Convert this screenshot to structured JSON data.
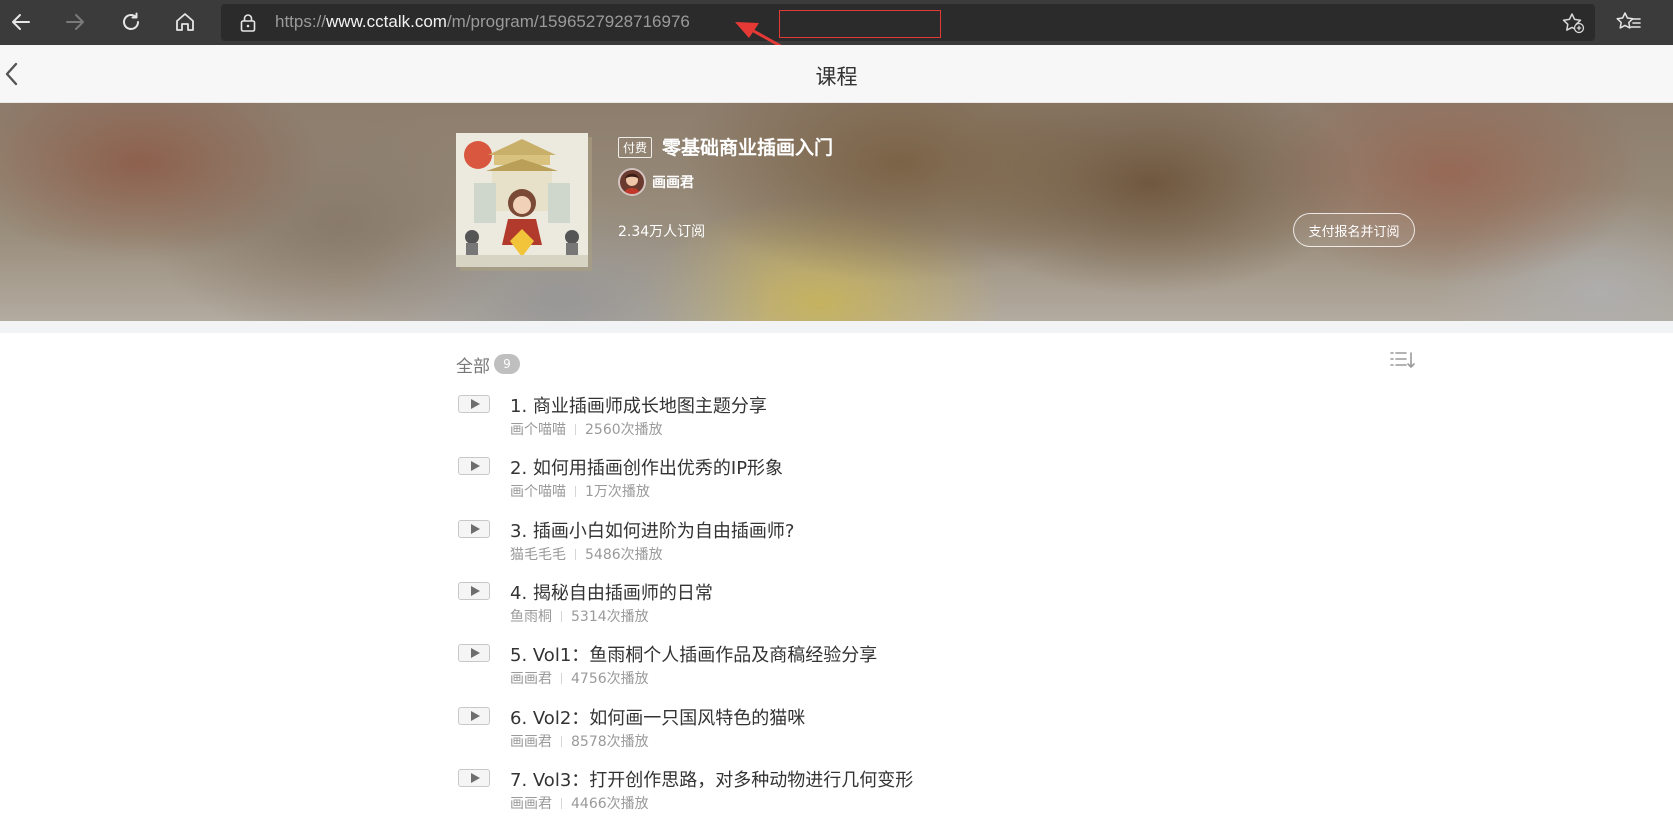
{
  "browser": {
    "url_prefix": "https://",
    "url_host": "www.cctalk.com",
    "url_path": "/m/program/",
    "url_id": "1596527928716976",
    "icons": [
      "back-icon",
      "forward-icon",
      "refresh-icon",
      "home-icon",
      "lock-icon",
      "add-favorite-icon",
      "favorites-icon"
    ]
  },
  "header": {
    "title": "课程"
  },
  "course": {
    "paid_tag": "付费",
    "title": "零基础商业插画入门",
    "author": "画画君",
    "subscribers": "2.34万人订阅",
    "subscribe_button": "支付报名并订阅"
  },
  "list": {
    "all_label": "全部",
    "count": "9",
    "lessons": [
      {
        "title": "1. 商业插画师成长地图主题分享",
        "author": "画个喵喵",
        "plays": "2560次播放"
      },
      {
        "title": "2. 如何用插画创作出优秀的IP形象",
        "author": "画个喵喵",
        "plays": "1万次播放"
      },
      {
        "title": "3. 插画小白如何进阶为自由插画师?",
        "author": "猫毛毛毛",
        "plays": "5486次播放"
      },
      {
        "title": "4. 揭秘自由插画师的日常",
        "author": "鱼雨桐",
        "plays": "5314次播放"
      },
      {
        "title": "5. Vol1：鱼雨桐个人插画作品及商稿经验分享",
        "author": "画画君",
        "plays": "4756次播放"
      },
      {
        "title": "6. Vol2：如何画一只国风特色的猫咪",
        "author": "画画君",
        "plays": "8578次播放"
      },
      {
        "title": "7. Vol3：打开创作思路，对多种动物进行几何变形",
        "author": "画画君",
        "plays": "4466次播放"
      }
    ]
  },
  "colors": {
    "toolbar": "#3b3b3b",
    "url_bar": "#2b2b2b",
    "annotation": "#e53935"
  }
}
